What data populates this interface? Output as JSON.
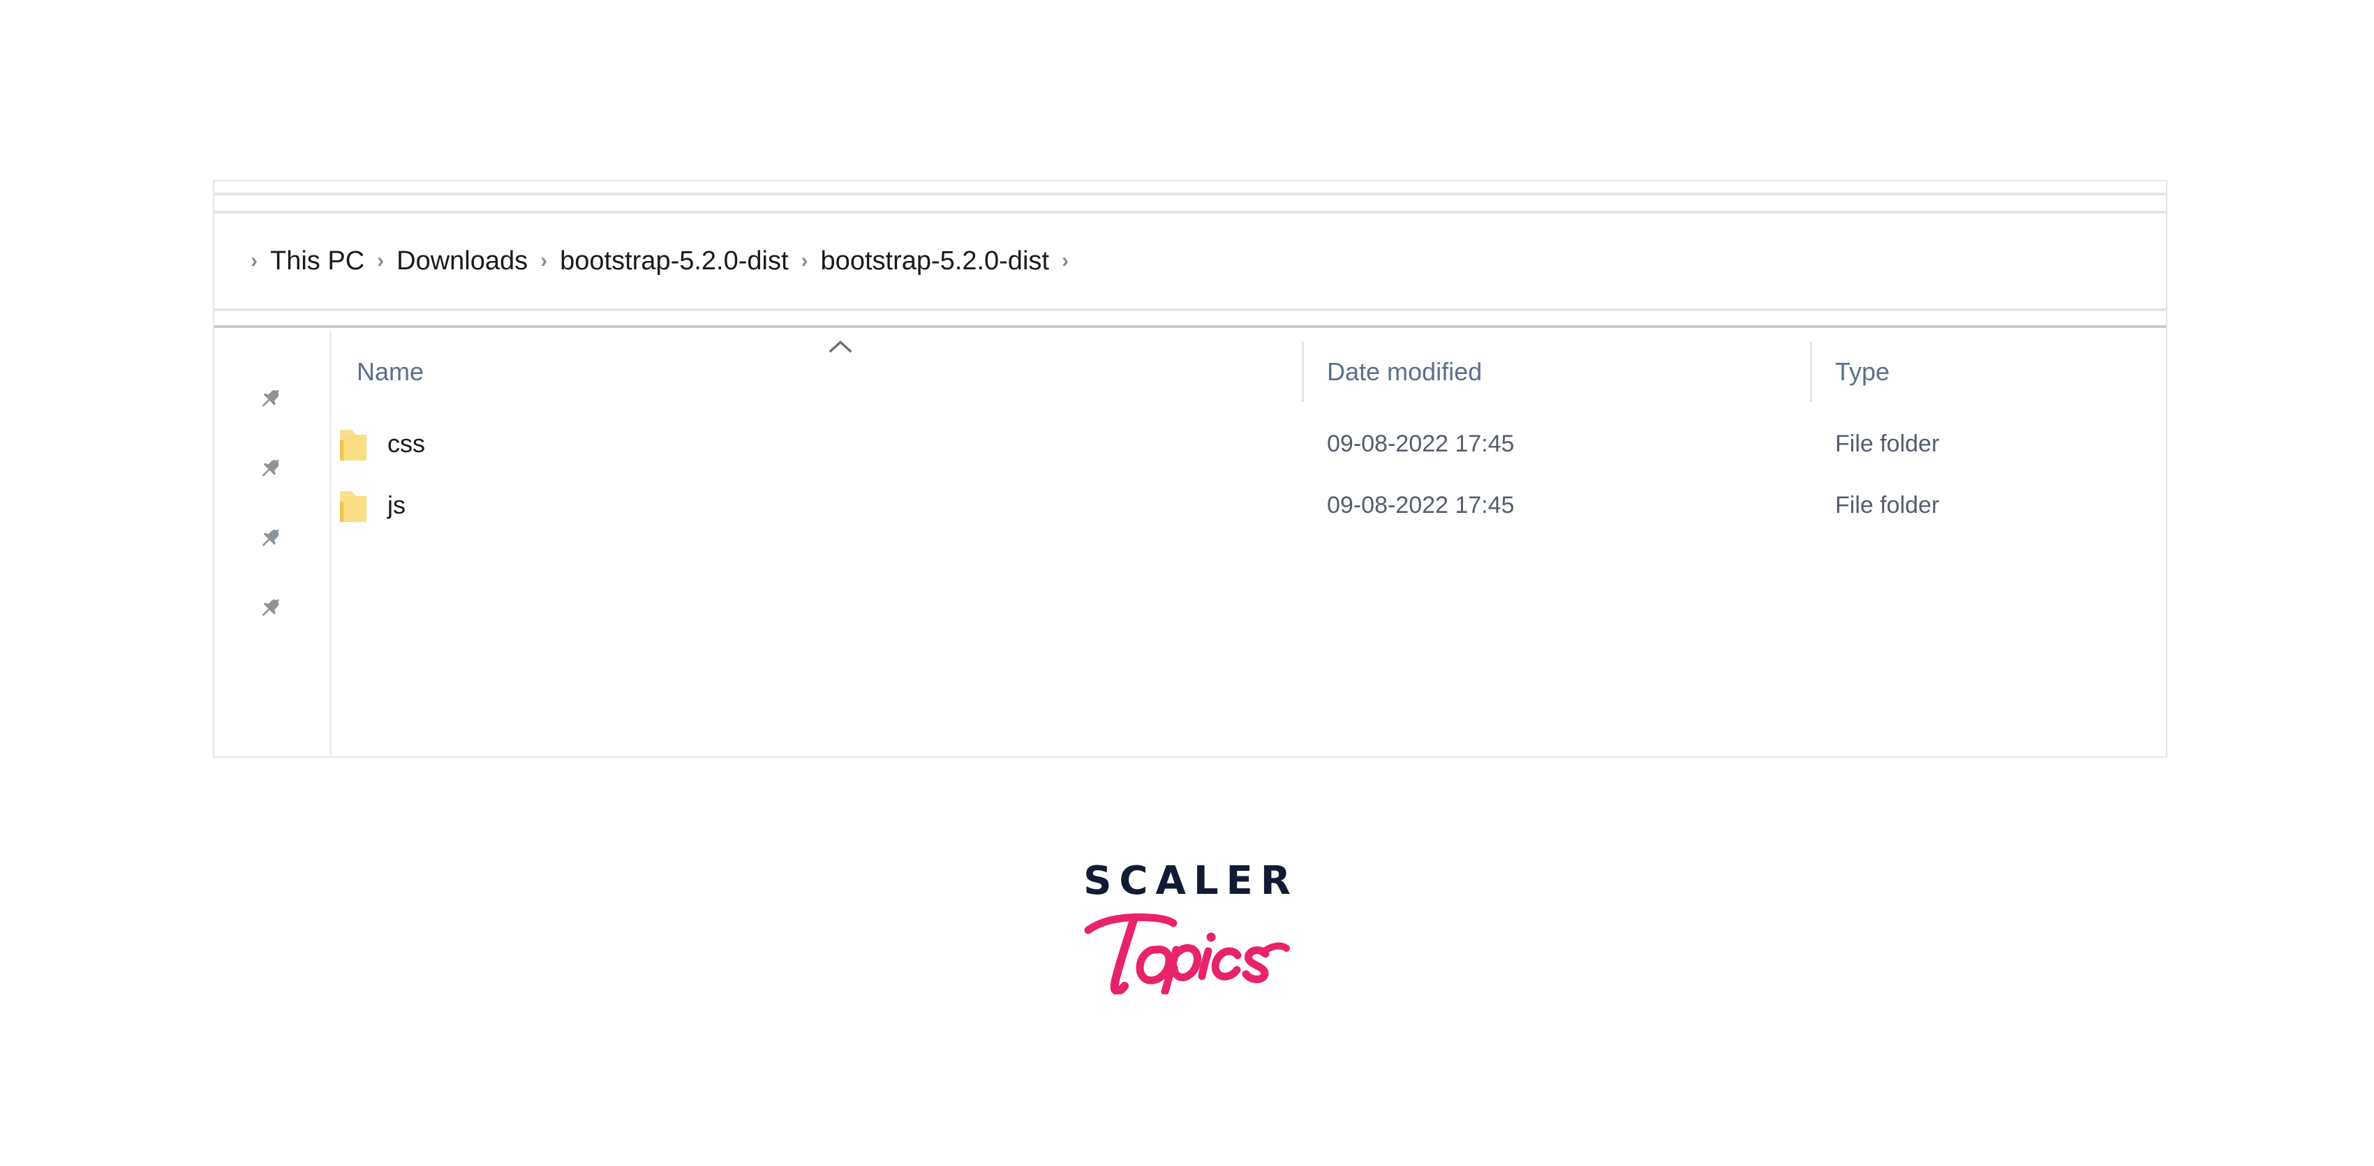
{
  "window": {
    "name": "file-explorer-window"
  },
  "address_bar": {
    "breadcrumb": [
      {
        "label": "This PC"
      },
      {
        "label": "Downloads"
      },
      {
        "label": "bootstrap-5.2.0-dist"
      },
      {
        "label": "bootstrap-5.2.0-dist"
      }
    ],
    "separator": "›"
  },
  "nav_pane": {
    "pins": [
      {
        "icon": "pin-icon"
      },
      {
        "icon": "pin-icon"
      },
      {
        "icon": "pin-icon"
      },
      {
        "icon": "pin-icon"
      }
    ]
  },
  "file_list": {
    "columns": [
      {
        "key": "name",
        "label": "Name",
        "sorted": "ascending",
        "sort_icon": "chevron-up-icon"
      },
      {
        "key": "date_modified",
        "label": "Date modified"
      },
      {
        "key": "type",
        "label": "Type"
      }
    ],
    "rows": [
      {
        "icon": "folder-icon",
        "name": "css",
        "date_modified": "09-08-2022 17:45",
        "type": "File folder"
      },
      {
        "icon": "folder-icon",
        "name": "js",
        "date_modified": "09-08-2022 17:45",
        "type": "File folder"
      }
    ]
  },
  "logo": {
    "primary": "SCALER",
    "secondary": "Topics"
  },
  "colors": {
    "header_text": "#5b6f8c",
    "body_text": "#1a1a1a",
    "meta_text": "#555d6b",
    "folder_gold": "#f6cd5f",
    "folder_gold_light": "#fde8a8",
    "pin_gray": "#8c9399",
    "logo_navy": "#111c34",
    "logo_pink": "#e8226b",
    "window_border": "#e6e6e6",
    "divider": "#e4e4e4"
  }
}
